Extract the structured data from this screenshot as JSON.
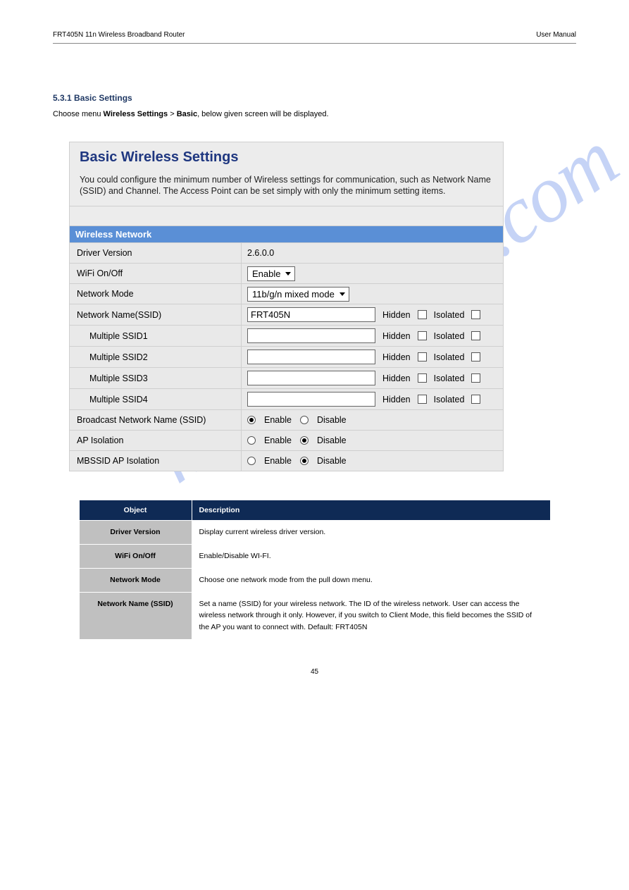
{
  "header": {
    "left": "FRT405N 11n Wireless Broadband Router",
    "right": "User Manual"
  },
  "section": {
    "title": "5.3.1 Basic Settings",
    "body_prefix": "Choose menu ",
    "body_bold1": "Wireless Settings",
    "body_mid": " > ",
    "body_bold2": "Basic",
    "body_suffix": ", below given screen will be displayed."
  },
  "watermark": "manualshive.com",
  "ui": {
    "title": "Basic Wireless Settings",
    "desc": "You could configure the minimum number of Wireless settings for communication, such as Network Name (SSID) and Channel. The Access Point can be set simply with only the minimum setting items.",
    "section_label": "Wireless Network",
    "rows": {
      "driver_label": "Driver Version",
      "driver_value": "2.6.0.0",
      "wifi_label": "WiFi On/Off",
      "wifi_value": "Enable",
      "mode_label": "Network Mode",
      "mode_value": "11b/g/n mixed mode",
      "ssid_label": "Network Name(SSID)",
      "ssid_value": "FRT405N",
      "m1_label": "Multiple SSID1",
      "m2_label": "Multiple SSID2",
      "m3_label": "Multiple SSID3",
      "m4_label": "Multiple SSID4",
      "hidden_text": "Hidden",
      "isolated_text": "Isolated",
      "broadcast_label": "Broadcast Network Name (SSID)",
      "ap_label": "AP Isolation",
      "mbssid_label": "MBSSID AP Isolation",
      "enable_text": "Enable",
      "disable_text": "Disable"
    }
  },
  "def": {
    "h_obj": "Object",
    "h_desc": "Description",
    "r1k": "Driver Version",
    "r1v": "Display current wireless driver version.",
    "r2k": "WiFi On/Off",
    "r2v": "Enable/Disable WI-FI.",
    "r3k": "Network Mode",
    "r3v": "Choose one network mode from the pull down menu.",
    "r4k": "Network Name (SSID)",
    "r4v": "Set a name (SSID) for your wireless network. The ID of the wireless network. User can access the wireless network through it only. However, if you switch to Client Mode, this field becomes the SSID of the AP you want to connect with. Default: FRT405N"
  },
  "footer": "45"
}
